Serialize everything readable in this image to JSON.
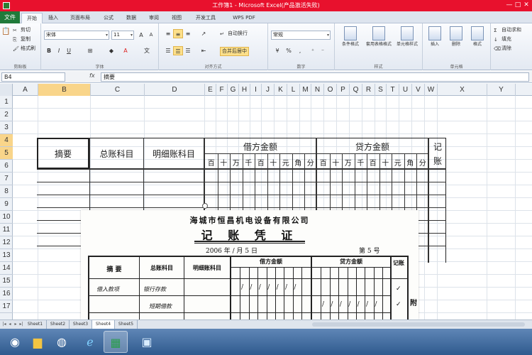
{
  "window": {
    "title": "工作簿1 - Microsoft Excel(产品激活失败)",
    "controls": [
      "—",
      "□",
      "✕"
    ]
  },
  "ribbon_tabs": [
    {
      "label": "开始",
      "active": true
    },
    {
      "label": "插入"
    },
    {
      "label": "页面布局"
    },
    {
      "label": "公式"
    },
    {
      "label": "数据"
    },
    {
      "label": "审阅"
    },
    {
      "label": "视图"
    },
    {
      "label": "开发工具"
    },
    {
      "label": "WPS PDF"
    }
  ],
  "file_tab": "文件",
  "ribbon": {
    "clipboard": {
      "cut": "剪切",
      "copy": "复制",
      "format_painter": "格式刷",
      "label": "剪贴板"
    },
    "font": {
      "name": "宋体",
      "size": "11",
      "label": "字体"
    },
    "alignment": {
      "wrap": "自动换行",
      "merge": "合并后居中",
      "label": "对齐方式"
    },
    "number": {
      "format": "常规",
      "label": "数字"
    },
    "styles": {
      "conditional": "条件格式",
      "table": "套用表格格式",
      "cell_styles": "单元格样式",
      "label": "样式"
    },
    "cells": {
      "insert": "插入",
      "delete": "删除",
      "format": "格式",
      "label": "单元格"
    },
    "editing": {
      "autosum": "自动求和",
      "fill": "填充",
      "clear": "清除"
    }
  },
  "formula_bar": {
    "name_box": "B4",
    "fx": "fx",
    "content": "摘要"
  },
  "columns": [
    "A",
    "B",
    "C",
    "D",
    "E",
    "F",
    "G",
    "H",
    "I",
    "J",
    "K",
    "L",
    "M",
    "N",
    "O",
    "P",
    "Q",
    "R",
    "S",
    "T",
    "U",
    "V",
    "W",
    "X",
    "Y"
  ],
  "rows": [
    "1",
    "2",
    "3",
    "4",
    "5",
    "6",
    "7",
    "8",
    "9",
    "10",
    "11",
    "12",
    "13",
    "14",
    "15",
    "16",
    "17"
  ],
  "selected_cell": {
    "column": "B",
    "row": "4"
  },
  "form": {
    "summary": "摘要",
    "general_account": "总账科目",
    "detail_account": "明细账科目",
    "debit_amount": "借方金额",
    "credit_amount": "贷方金额",
    "posted": "记",
    "posted_2": "账",
    "units": [
      "百",
      "十",
      "万",
      "千",
      "百",
      "十",
      "元",
      "角",
      "分"
    ]
  },
  "voucher": {
    "company": "海城市恒昌机电设备有限公司",
    "title": "记 账 凭 证",
    "date": "2006 年 / 月 5 日",
    "number": "第 5 号",
    "summary": "摘  要",
    "general_account": "总账科目",
    "detail_account": "明细账科目",
    "debit": "借方金额",
    "credit": "贷方金额",
    "posted": "记账",
    "row1_summary": "借入款项",
    "row1_account": "银行存款",
    "row2_account": "短期借款",
    "side_note": "附"
  },
  "sheet_tabs": [
    "Sheet1",
    "Sheet2",
    "Sheet3",
    "Sheet4",
    "Sheet5"
  ],
  "active_sheet": "Sheet4",
  "taskbar": [
    {
      "icon": "start-orb-icon"
    },
    {
      "icon": "file-explorer-icon"
    },
    {
      "icon": "chrome-icon"
    },
    {
      "icon": "ie-icon"
    },
    {
      "icon": "excel-icon",
      "active": true
    },
    {
      "icon": "wps-icon"
    }
  ],
  "colors": {
    "title_bar": "#e8112d",
    "file_tab": "#1f7a3a",
    "selection_header": "#f9d58a",
    "taskbar": "#2f5a8e"
  }
}
